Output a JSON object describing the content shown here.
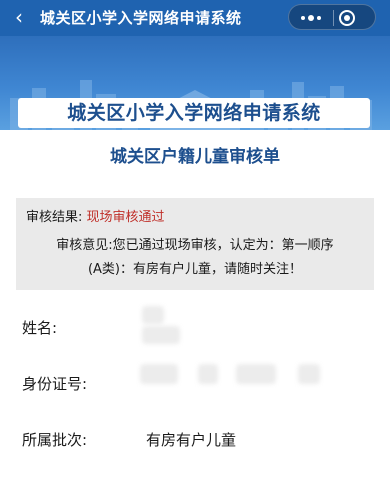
{
  "nav": {
    "title": "城关区小学入学网络申请系统",
    "back_icon": "chevron-left-icon",
    "more_icon": "more-dots-icon",
    "close_icon": "mini-program-close-icon"
  },
  "banner": {
    "title": "城关区小学入学网络申请系统"
  },
  "form": {
    "title": "城关区户籍儿童审核单",
    "result_label": "审核结果:",
    "result_value": "现场审核通过",
    "opinion_line1": "审核意见:您已通过现场审核，认定为：第一顺序",
    "opinion_line2": "(A类)：有房有户儿童，请随时关注！",
    "fields": {
      "name_label": "姓名:",
      "id_label": "身份证号:",
      "batch_label": "所属批次:",
      "batch_value": "有房有户儿童"
    }
  },
  "colors": {
    "nav_bg": "#1f63b0",
    "title_blue": "#1d4f8e",
    "result_red": "#c0302a"
  }
}
